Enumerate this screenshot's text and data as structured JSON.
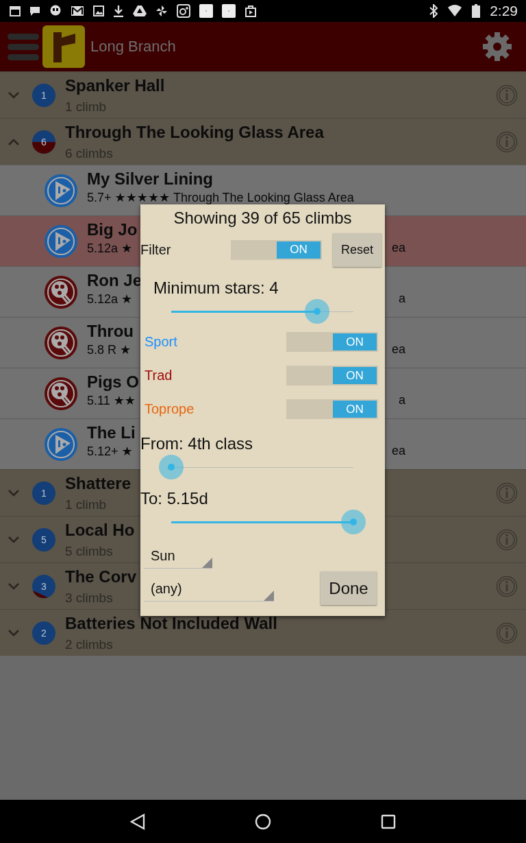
{
  "status_bar": {
    "time": "2:29"
  },
  "app_bar": {
    "title": "Long Branch"
  },
  "groups": [
    {
      "name": "Spanker Hall",
      "count": "1 climb",
      "badge": "1",
      "kind": "sport",
      "expanded": false
    },
    {
      "name": "Through The Looking Glass Area",
      "count": "6 climbs",
      "badge": "6",
      "kind": "half",
      "expanded": true,
      "children": [
        {
          "name": "My Silver Lining",
          "meta": "5.7+ ★★★★★ Through The Looking Glass Area",
          "kind": "sport",
          "selected": false
        },
        {
          "name": "Big Jo",
          "meta": "5.12a ★",
          "tail": "ea",
          "kind": "sport",
          "selected": true
        },
        {
          "name": "Ron Je",
          "meta": "5.12a ★",
          "tail": "a",
          "kind": "trad",
          "selected": false
        },
        {
          "name": "Throu",
          "meta": "5.8 R ★",
          "tail": "ea",
          "kind": "trad",
          "selected": false
        },
        {
          "name": "Pigs O",
          "meta": "5.11 ★★",
          "tail": "a",
          "kind": "trad",
          "selected": false
        },
        {
          "name": "The Li",
          "meta": "5.12+ ★",
          "tail": "ea",
          "kind": "sport",
          "selected": false
        }
      ]
    },
    {
      "name": "Shattere",
      "count": "1 climb",
      "badge": "1",
      "kind": "sport",
      "expanded": false
    },
    {
      "name": "Local Ho",
      "count": "5 climbs",
      "badge": "5",
      "kind": "sport",
      "expanded": false
    },
    {
      "name": "The Corv",
      "count": "3 climbs",
      "badge": "3",
      "kind": "wedge",
      "expanded": false
    },
    {
      "name": "Batteries Not Included Wall",
      "count": "2 climbs",
      "badge": "2",
      "kind": "sport",
      "expanded": false
    }
  ],
  "dialog": {
    "title": "Showing 39 of 65 climbs",
    "filter": {
      "label": "Filter",
      "toggle": "ON",
      "on": true
    },
    "reset_button": "Reset",
    "min_stars": {
      "label": "Minimum stars: 4",
      "level": 0.8
    },
    "types": [
      {
        "label": "Sport",
        "color": "#1e90ff",
        "toggle": "ON",
        "on": true
      },
      {
        "label": "Trad",
        "color": "#a00c0c",
        "toggle": "ON",
        "on": true
      },
      {
        "label": "Toprope",
        "color": "#e8650f",
        "toggle": "ON",
        "on": true
      }
    ],
    "from": {
      "label": "From: 4th class",
      "level": 0
    },
    "to": {
      "label": "To: 5.15d",
      "level": 1
    },
    "sun": {
      "value": "Sun"
    },
    "area": {
      "value": "(any)"
    },
    "done_button": "Done"
  }
}
